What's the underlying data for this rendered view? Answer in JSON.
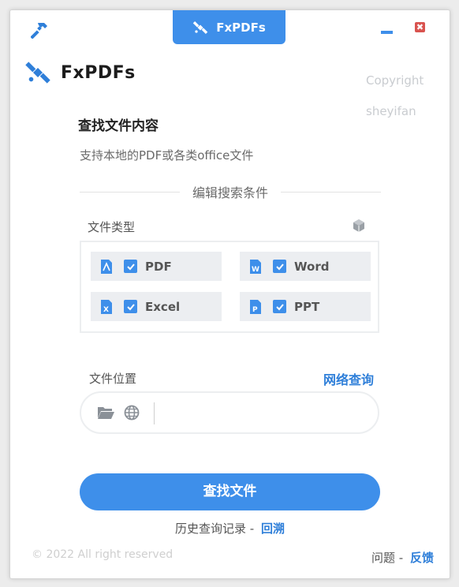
{
  "app": {
    "title": "FxPDFs",
    "brand": "FxPDFs"
  },
  "window_controls": {
    "close_symbol": "✖"
  },
  "copyright_side": {
    "line1": "Copyright",
    "line2": "sheyifan"
  },
  "main": {
    "heading": "查找文件内容",
    "subtext": "支持本地的PDF或各类office文件",
    "section_title": "编辑搜索条件",
    "file_type_label": "文件类型",
    "file_types": [
      {
        "label": "PDF",
        "icon": "pdf-file-icon",
        "checked": true
      },
      {
        "label": "Word",
        "icon": "word-file-icon",
        "checked": true
      },
      {
        "label": "Excel",
        "icon": "excel-file-icon",
        "checked": true
      },
      {
        "label": "PPT",
        "icon": "ppt-file-icon",
        "checked": true
      }
    ],
    "location_label": "文件位置",
    "network_link": "网络查询",
    "path_value": "",
    "search_button": "查找文件",
    "history_text": "历史查询记录 -",
    "history_link": "回溯"
  },
  "footer": {
    "copyright": "© 2022 All right reserved",
    "feedback_text": "问题 -",
    "feedback_link": "反馈"
  },
  "colors": {
    "accent": "#3e8fea",
    "link": "#2f7fd9",
    "close": "#d9534f"
  }
}
